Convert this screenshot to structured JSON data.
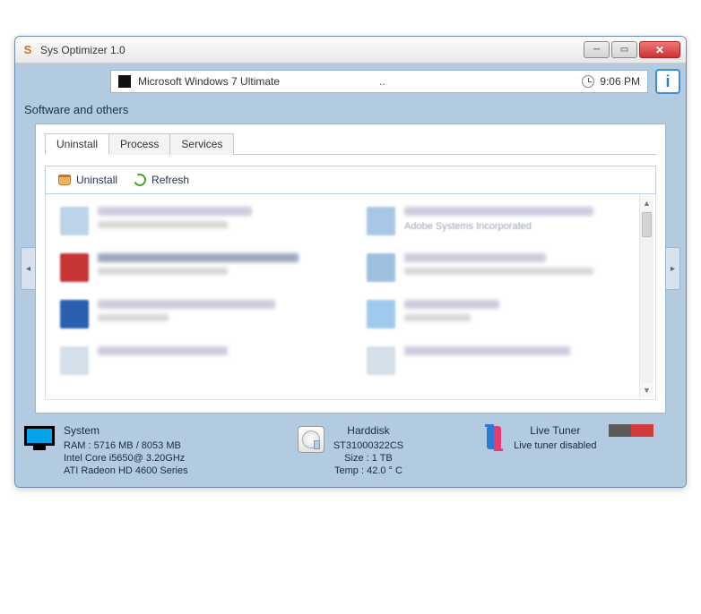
{
  "window": {
    "title": "Sys Optimizer 1.0"
  },
  "topbar": {
    "os_name": "Microsoft Windows 7 Ultimate",
    "dots": "..",
    "time": "9:06 PM",
    "info_label": "i"
  },
  "section_title": "Software and others",
  "tabs": [
    {
      "label": "Uninstall",
      "active": true
    },
    {
      "label": "Process",
      "active": false
    },
    {
      "label": "Services",
      "active": false
    }
  ],
  "toolbar": {
    "uninstall_label": "Uninstall",
    "refresh_label": "Refresh"
  },
  "apps": [
    {
      "vendor": ""
    },
    {
      "vendor": "Adobe Systems Incorporated"
    },
    {
      "vendor": ""
    },
    {
      "vendor": ""
    },
    {
      "vendor": ""
    },
    {
      "vendor": ""
    },
    {
      "vendor": ""
    },
    {
      "vendor": ""
    }
  ],
  "status": {
    "system": {
      "title": "System",
      "ram": "RAM : 5716 MB / 8053 MB",
      "cpu": "Intel Core i5650@ 3.20GHz",
      "gpu": "ATI Radeon HD 4600 Series"
    },
    "harddisk": {
      "title": "Harddisk",
      "model": "ST31000322CS",
      "size": "Size : 1 TB",
      "temp": "Temp : 42.0 ° C"
    },
    "tuner": {
      "title": "Live Tuner",
      "state": "Live tuner disabled"
    }
  }
}
